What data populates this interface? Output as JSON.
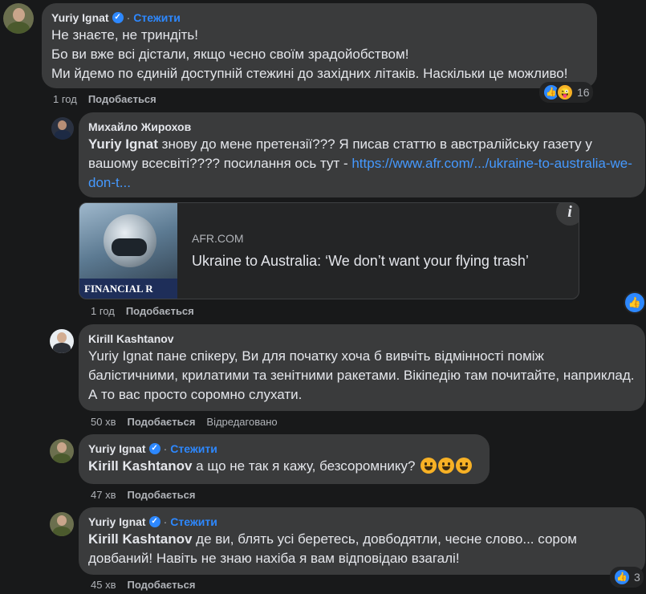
{
  "comments": [
    {
      "author": "Yuriy Ignat",
      "follow": "Стежити",
      "lines": [
        "Не знаєте, не триндіть!",
        "Бо ви вже всі дістали, якщо чесно своїм зрадойобством!",
        "Ми йдемо по єдиній доступній стежині до західних літаків. Наскільки це можливо!"
      ],
      "time": "1 год",
      "like_label": "Подобається",
      "reaction_count": "16"
    },
    {
      "author": "Михайло Жирохов",
      "mention": "Yuriy Ignat",
      "text_before_link": " знову до мене претензії??? Я писав статтю в австралійську газету у вашому всесвіті???? посилання ось тут - ",
      "link_text": "https://www.afr.com/.../ukraine-to-australia-we-don-t...",
      "card": {
        "domain": "AFR.COM",
        "title": "Ukraine to Australia: ‘We don’t want your flying trash’",
        "thumb_text": "FINANCIAL R"
      },
      "time": "1 год",
      "like_label": "Подобається"
    },
    {
      "author": "Kirill Kashtanov",
      "mention": "Yuriy Ignat",
      "text": " пане спікеру, Ви для початку хоча б вивчіть відмінності поміж балістичними, крилатими та зенітними ракетами. Вікіпедію там почитайте, наприклад. А то вас просто соромно слухати.",
      "time": "50 хв",
      "like_label": "Подобається",
      "edited_label": "Відредаговано"
    },
    {
      "author": "Yuriy Ignat",
      "follow": "Стежити",
      "mention": "Kirill Kashtanov",
      "text": " а що не так я кажу, безсоромнику? ",
      "time": "47 хв",
      "like_label": "Подобається"
    },
    {
      "author": "Yuriy Ignat",
      "follow": "Стежити",
      "mention": "Kirill Kashtanov",
      "text": " де ви, блять усі беретесь, довбодятли, чесне слово... сором довбаний! Навіть не знаю нахіба я вам відповідаю взагалі!",
      "time": "45 хв",
      "like_label": "Подобається",
      "reaction_count": "3"
    }
  ],
  "icons": {
    "verified": "verified-badge-icon",
    "like": "like-reaction-icon",
    "haha": "haha-reaction-icon",
    "info": "info-icon",
    "grin": "grinning-emoji-icon"
  },
  "colors": {
    "background": "#18191a",
    "bubble": "#3a3b3c",
    "accent": "#2d88ff",
    "text": "#e4e6eb",
    "muted": "#b0b3b8"
  }
}
